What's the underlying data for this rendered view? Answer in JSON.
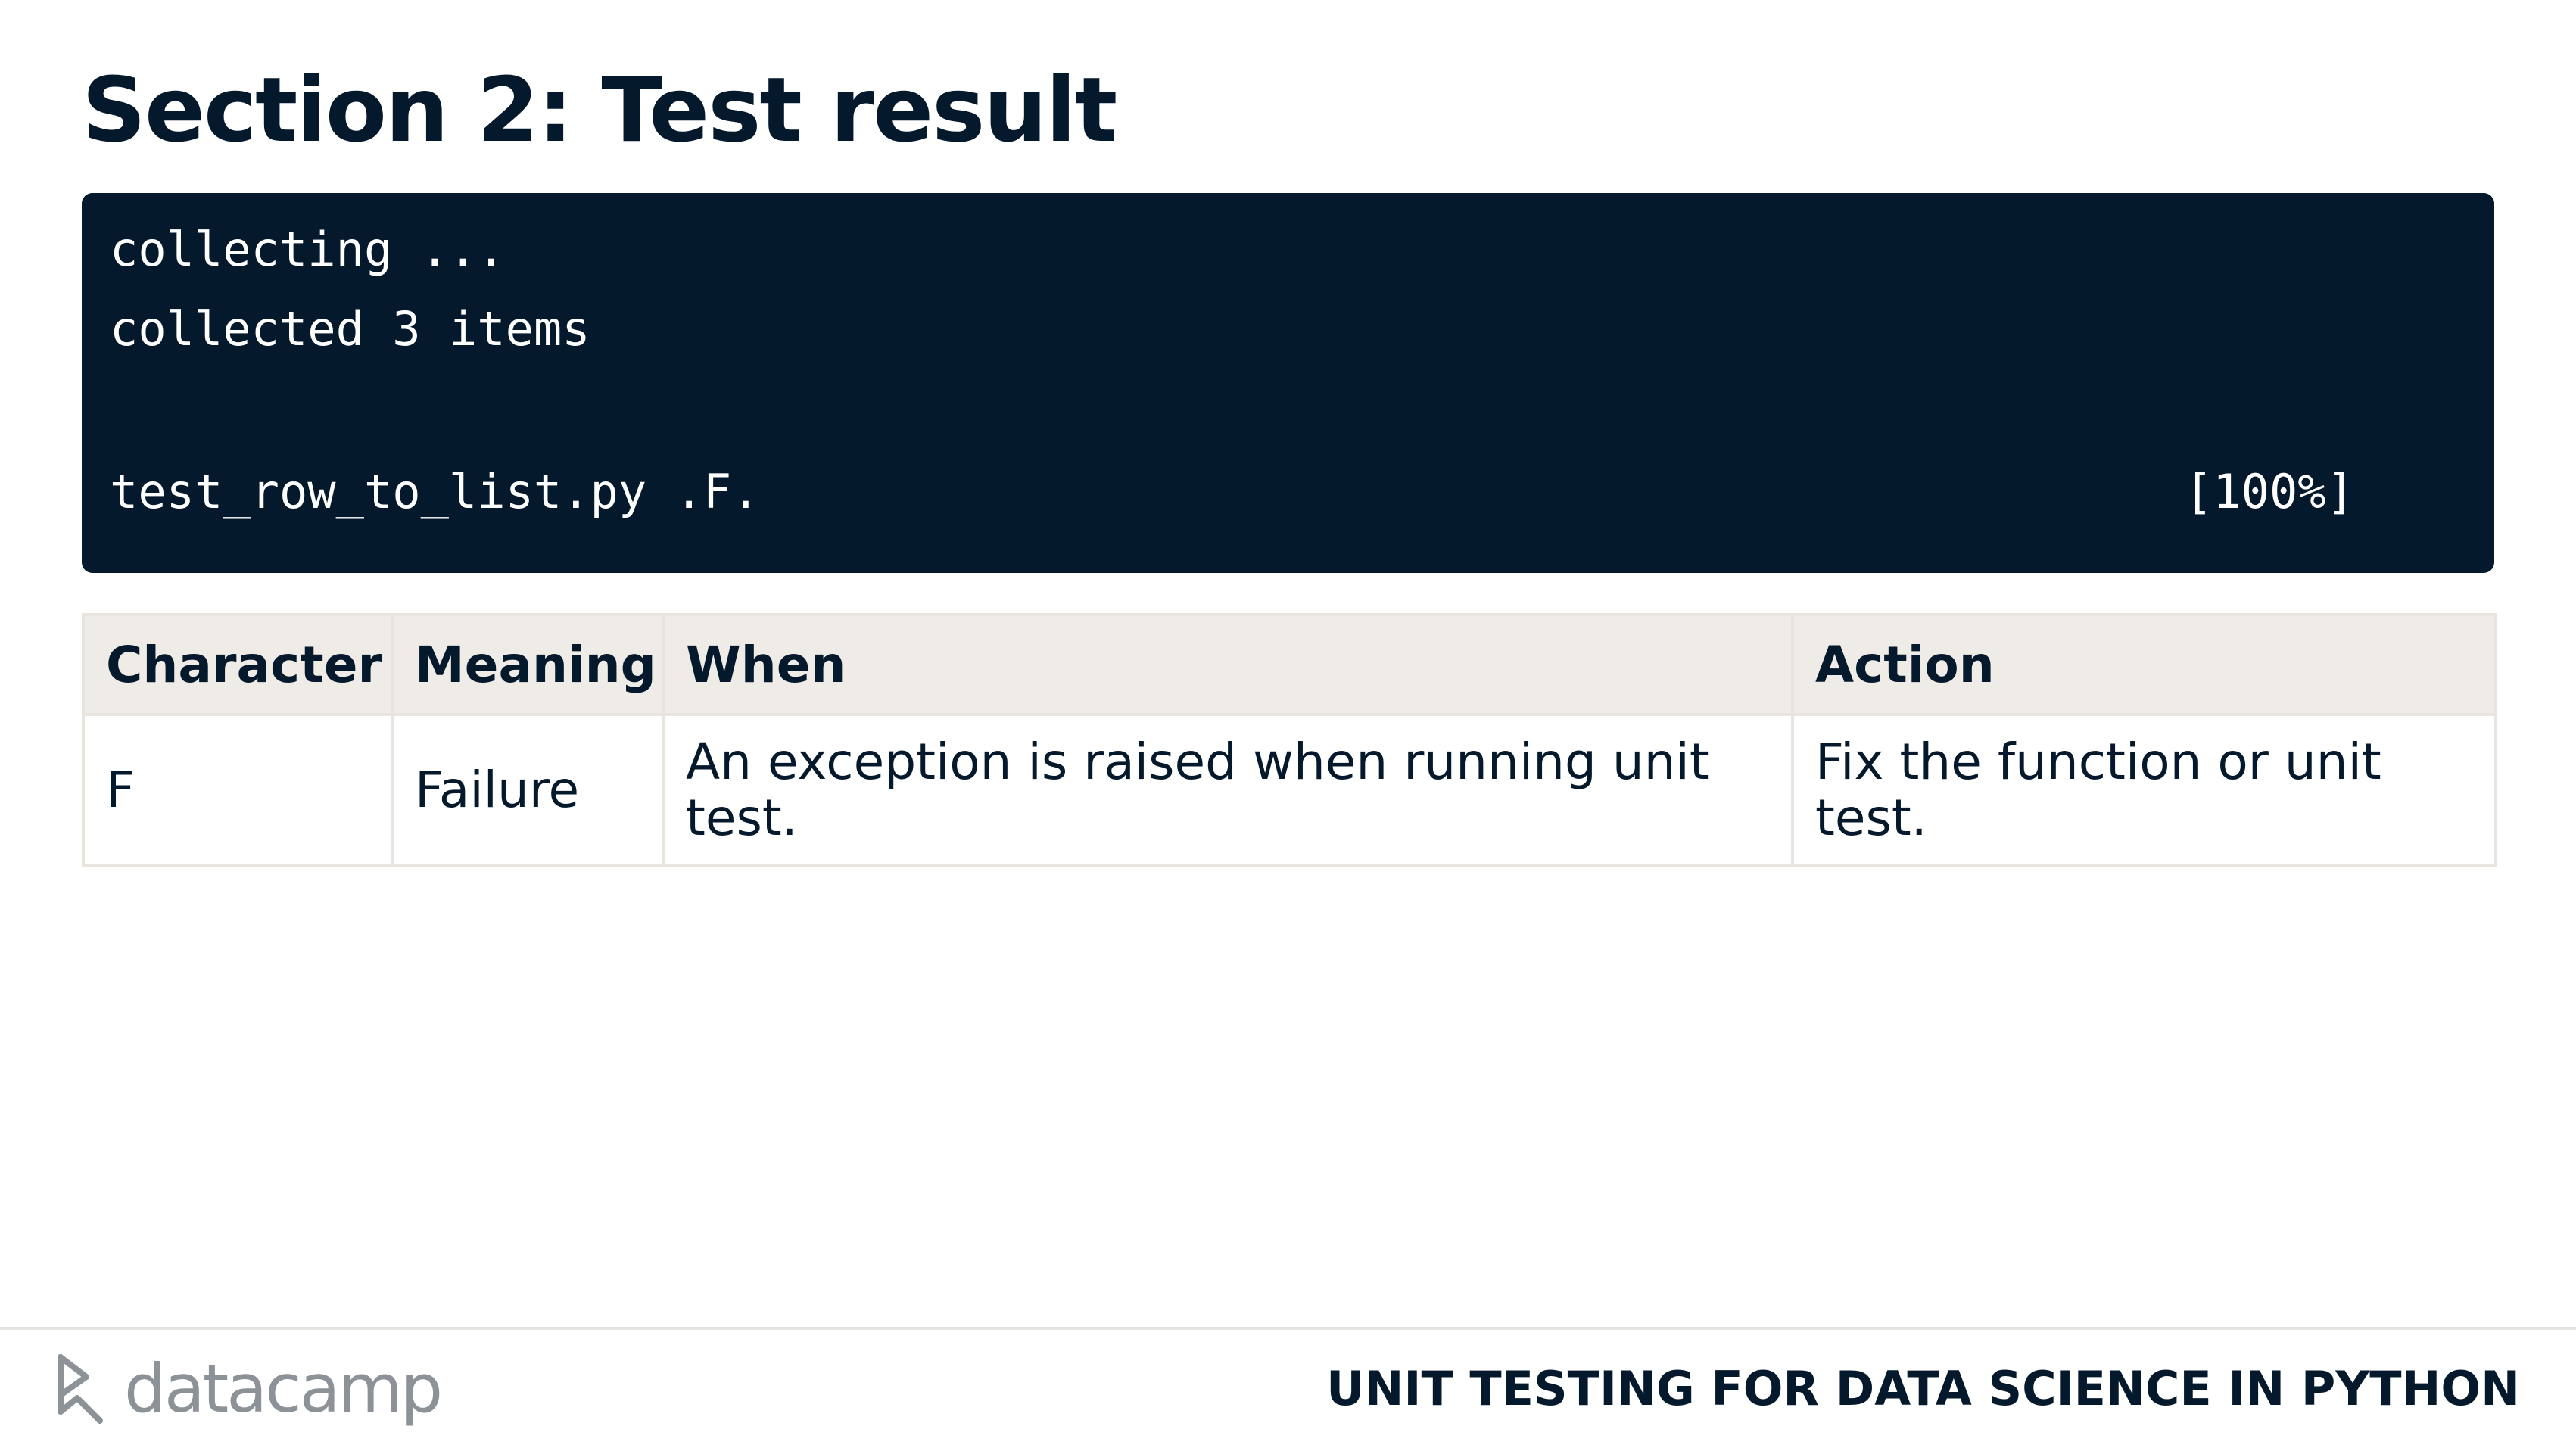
{
  "slide": {
    "title": "Section 2: Test result"
  },
  "terminal": {
    "lines": [
      "collecting ...",
      "collected 3 items"
    ],
    "result_line": "test_row_to_list.py .F.",
    "progress": "[100%]"
  },
  "table": {
    "headers": [
      "Character",
      "Meaning",
      "When",
      "Action"
    ],
    "rows": [
      [
        "F",
        "Failure",
        "An exception is raised when running unit test.",
        "Fix the function or unit test."
      ]
    ]
  },
  "footer": {
    "logo_text": "datacamp",
    "logo_icon": "datacamp-logo-icon",
    "course_title": "UNIT TESTING FOR DATA SCIENCE IN PYTHON"
  },
  "colors": {
    "navy": "#05192d",
    "header_bg": "#efebe6",
    "border": "#e8e4df",
    "logo_gray": "#8d9299"
  }
}
